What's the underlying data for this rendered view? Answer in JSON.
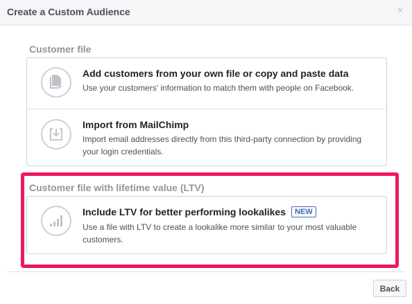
{
  "dialog": {
    "title": "Create a Custom Audience",
    "close_glyph": "×"
  },
  "sections": [
    {
      "label": "Customer file",
      "options": [
        {
          "icon": "file-add-icon",
          "title": "Add customers from your own file or copy and paste data",
          "description": "Use your customers' information to match them with people on Facebook."
        },
        {
          "icon": "import-icon",
          "title": "Import from MailChimp",
          "description": "Import email addresses directly from this third-party connection by providing your login credentials."
        }
      ]
    },
    {
      "label": "Customer file with lifetime value (LTV)",
      "options": [
        {
          "icon": "bar-chart-icon",
          "title": "Include LTV for better performing lookalikes",
          "badge": "NEW",
          "description": "Use a file with LTV to create a lookalike more similar to your most valuable customers."
        }
      ]
    }
  ],
  "footer": {
    "back_label": "Back"
  },
  "colors": {
    "highlight": "#f0185f",
    "badge": "#4267b2",
    "icon": "#bec2c9"
  }
}
